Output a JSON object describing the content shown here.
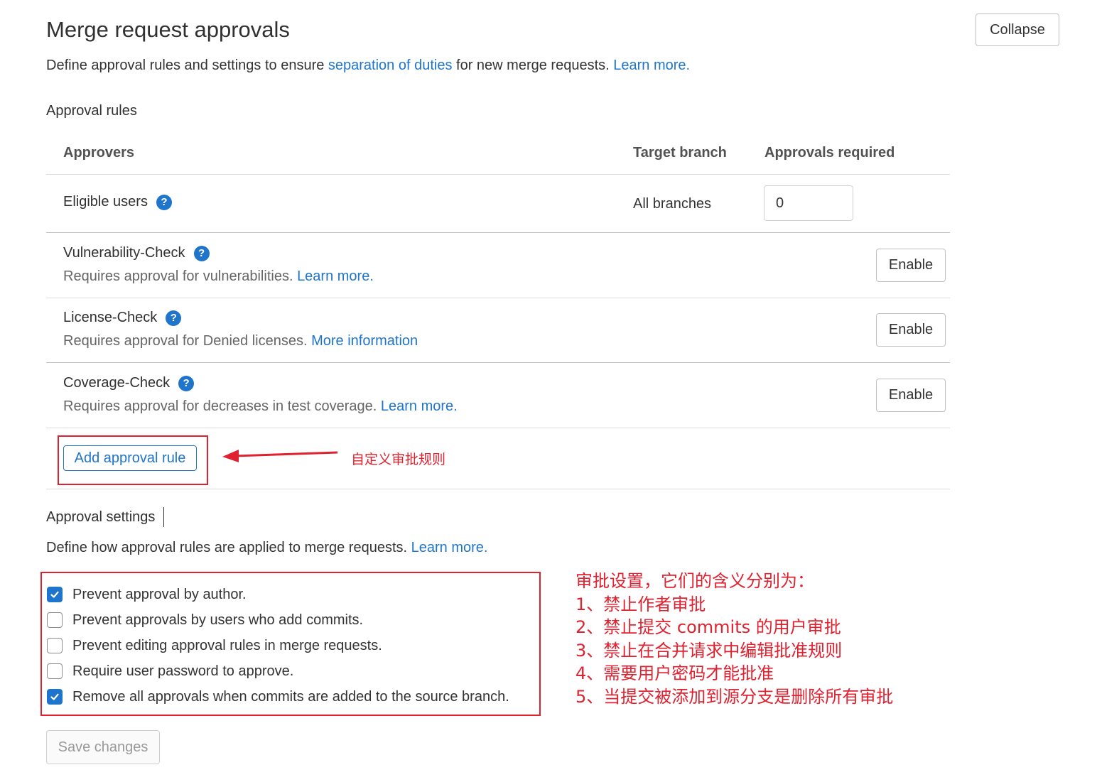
{
  "header": {
    "title": "Merge request approvals",
    "collapse_label": "Collapse",
    "description_prefix": "Define approval rules and settings to ensure ",
    "description_link": "separation of duties",
    "description_middle": " for new merge requests. ",
    "description_learn_more": "Learn more."
  },
  "approval_rules": {
    "heading": "Approval rules",
    "columns": {
      "approvers": "Approvers",
      "target_branch": "Target branch",
      "approvals_required": "Approvals required"
    },
    "eligible": {
      "label": "Eligible users",
      "target_branch": "All branches",
      "approvals_required": "0"
    },
    "rules": [
      {
        "name": "Vulnerability-Check",
        "description": "Requires approval for vulnerabilities. ",
        "link": "Learn more.",
        "button": "Enable"
      },
      {
        "name": "License-Check",
        "description": "Requires approval for Denied licenses. ",
        "link": "More information",
        "button": "Enable"
      },
      {
        "name": "Coverage-Check",
        "description": "Requires approval for decreases in test coverage. ",
        "link": "Learn more.",
        "button": "Enable"
      }
    ],
    "add_rule_label": "Add approval rule"
  },
  "approval_settings": {
    "heading": "Approval settings",
    "description": "Define how approval rules are applied to merge requests. ",
    "learn_more": "Learn more.",
    "options": [
      {
        "label": "Prevent approval by author.",
        "checked": true
      },
      {
        "label": "Prevent approvals by users who add commits.",
        "checked": false
      },
      {
        "label": "Prevent editing approval rules in merge requests.",
        "checked": false
      },
      {
        "label": "Require user password to approve.",
        "checked": false
      },
      {
        "label": "Remove all approvals when commits are added to the source branch.",
        "checked": true
      }
    ],
    "save_label": "Save changes"
  },
  "annotations": {
    "arrow_note": "自定义审批规则",
    "settings_notes": [
      "审批设置，它们的含义分别为：",
      "1、禁止作者审批",
      "2、禁止提交 commits 的用户审批",
      "3、禁止在合并请求中编辑批准规则",
      "4、需要用户密码才能批准",
      "5、当提交被添加到源分支是删除所有审批"
    ]
  },
  "colors": {
    "link": "#1f75cb",
    "annotation_red": "#e0212f",
    "checkbox_checked": "#1f75cb"
  }
}
